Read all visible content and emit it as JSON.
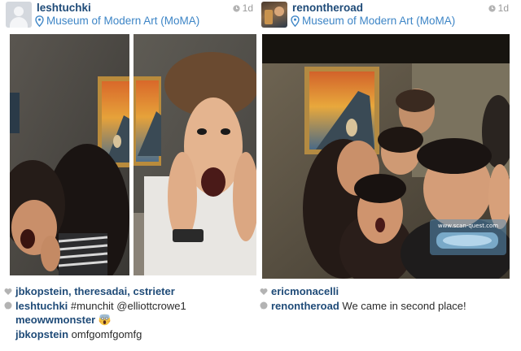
{
  "posts": [
    {
      "username": "leshtuchki",
      "location": "Museum of Modern Art (MoMA)",
      "time": "1d",
      "likes": "jbkopstein, theresadai, cstrieter",
      "comments": [
        {
          "user": "leshtuchki",
          "text": "#munchit @elliottcrowe1"
        },
        {
          "user": "meowwmonster",
          "text": "",
          "emoji": "screaming-face-icon"
        },
        {
          "user": "jbkopstein",
          "text": "omfgomfgomfg"
        }
      ]
    },
    {
      "username": "renontheroad",
      "location": "Museum of Modern Art (MoMA)",
      "time": "1d",
      "likes": "ericmonacelli",
      "comments": [
        {
          "user": "renontheroad",
          "text": "We came in second place!"
        }
      ],
      "watermark": "www.scan-quest.com"
    }
  ],
  "colors": {
    "username": "#1f4b78",
    "location": "#3d85c6",
    "time": "#9a9a9a",
    "icon_gray": "#b3b3b3"
  },
  "icons": [
    "pin-icon",
    "clock-icon",
    "heart-icon",
    "comment-icon",
    "screaming-face-icon",
    "avatar"
  ]
}
